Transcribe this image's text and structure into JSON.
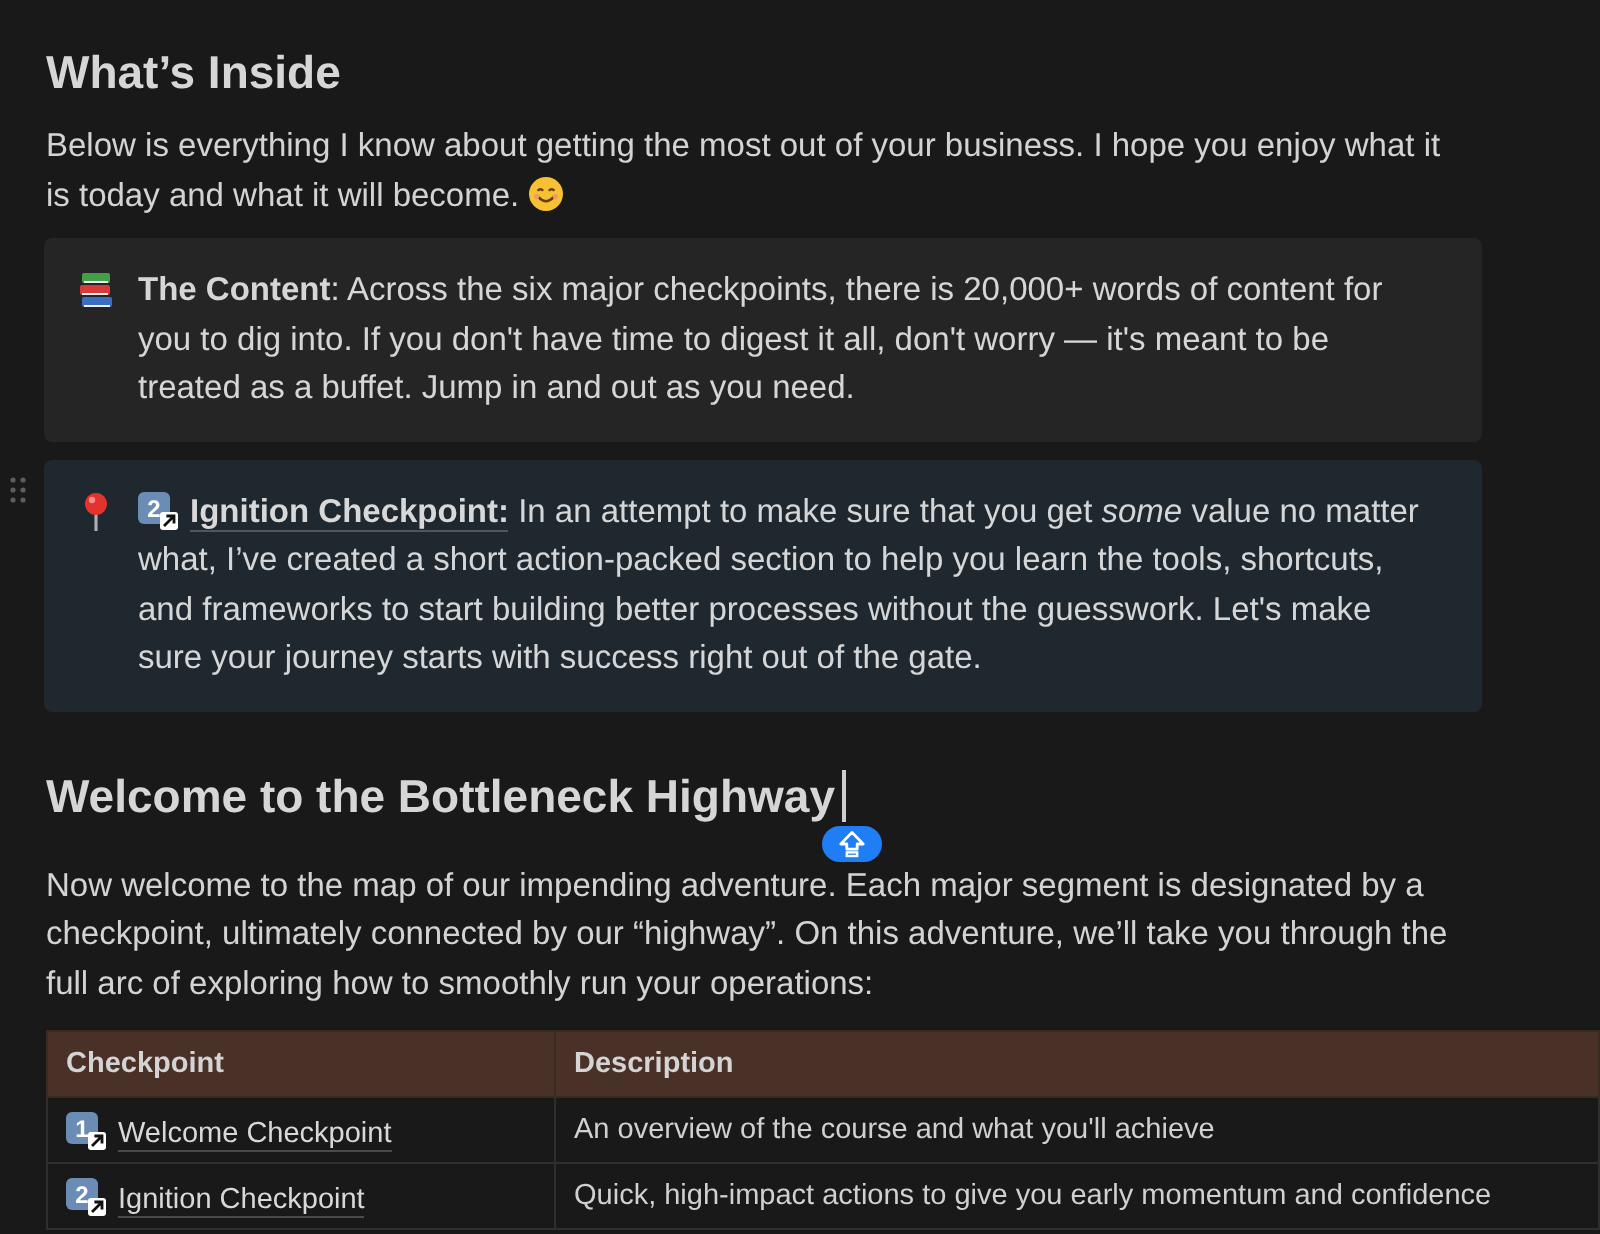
{
  "heading_1": "What’s Inside",
  "intro": "Below is everything I know about getting the most out of your business. I hope you enjoy what it is today and what it will become.",
  "callouts": [
    {
      "kind": "note",
      "color": "#252525",
      "hovered": false,
      "text": "**The Content**: Across the six major checkpoints, there is 20,000+ words of content for you to dig into. If you don't have time to digest it all, don't worry — it's meant to be treated as a buffet. Jump in and out as you need."
    },
    {
      "kind": "checkpoint",
      "color": "#1f282e",
      "hovered": true,
      "link": {
        "digit": "2",
        "label": "Ignition Checkpoint:"
      },
      "text": " In an attempt to make sure that you get *some* value no matter what, I’ve created a short action-packed section to help you learn the tools, shortcuts, and frameworks to start building better processes without the guesswork. Let's make sure your journey starts with success right out of the gate."
    }
  ],
  "heading_2": {
    "text": "Welcome to the Bottleneck Highway",
    "caret": true
  },
  "paragraph": "Now welcome to the map of our impending adventure. Each major segment is designated by a checkpoint, ultimately connected by our “highway”. On this adventure, we’ll take you through the full arc of exploring how to smoothly run your operations:",
  "table": {
    "columns": [
      "Checkpoint",
      "Description"
    ],
    "rows": [
      {
        "checkpoint": {
          "digit": "1",
          "label": "Welcome Checkpoint"
        },
        "description": "An overview of the course and what you'll achieve"
      },
      {
        "checkpoint": {
          "digit": "2",
          "label": "Ignition Checkpoint"
        },
        "description": "Quick, high-impact actions to give you early momentum and confidence"
      }
    ]
  }
}
